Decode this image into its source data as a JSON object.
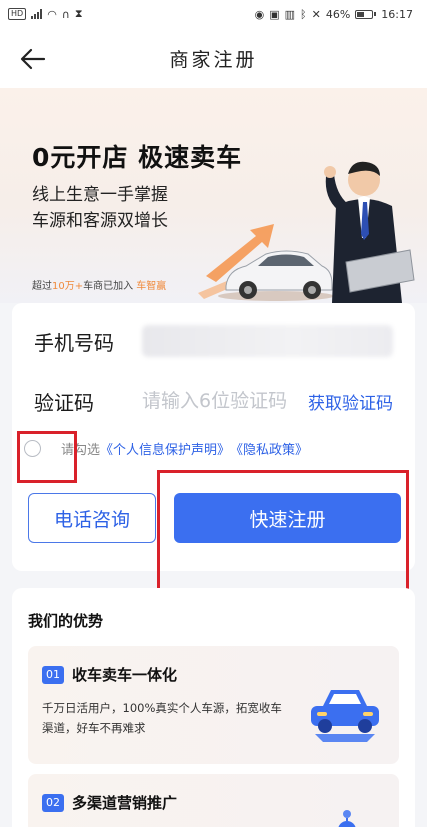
{
  "status_bar": {
    "battery": "46%",
    "time": "16:17"
  },
  "nav": {
    "title": "商家注册"
  },
  "banner": {
    "headline": "0元开店  极速卖车",
    "line1": "线上生意一手掌握",
    "line2": "车源和客源双增长",
    "joined_prefix": "超过",
    "joined_count": "10万+",
    "joined_mid": "车商已加入",
    "joined_brand": "车智赢"
  },
  "form": {
    "phone_label": "手机号码",
    "code_label": "验证码",
    "code_placeholder": "请输入6位验证码",
    "get_code": "获取验证码",
    "agree_text": "请勾选",
    "privacy_statement": "《个人信息保护声明》",
    "privacy_policy": "《隐私政策》",
    "call_button": "电话咨询",
    "register_button": "快速注册"
  },
  "advantages": {
    "title": "我们的优势",
    "items": [
      {
        "num": "01",
        "name": "收车卖车一体化",
        "desc": "千万日活用户，100%真实个人车源，拓宽收车渠道，好车不再难求"
      },
      {
        "num": "02",
        "name": "多渠道营销推广"
      }
    ]
  },
  "colors": {
    "primary": "#3b6ff0",
    "link": "#2e62e6",
    "highlight": "#f08a3c",
    "annotation": "#d9212a"
  }
}
